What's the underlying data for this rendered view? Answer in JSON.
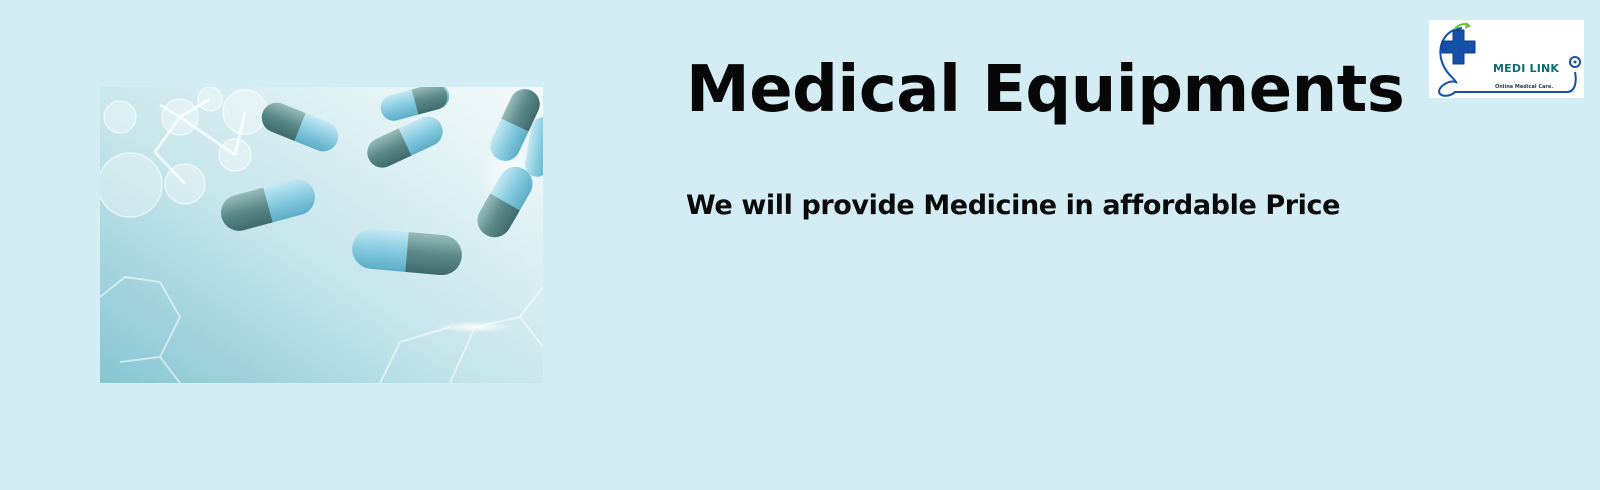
{
  "page": {
    "background": "#d4ecf4"
  },
  "hero": {
    "image_icon": "pill-capsules-image",
    "accent_color": "#5fb3c4"
  },
  "header": {
    "title": "Medical Equipments",
    "tagline": "We will provide Medicine in affordable Price"
  },
  "logo": {
    "name": "MEDI LINK",
    "tagline": "Online Medical Care.",
    "icon": "medical-cross-stethoscope-icon",
    "cross_color": "#1650a8",
    "text_color": "#0b6e72",
    "leaf_color": "#6cc04a"
  }
}
